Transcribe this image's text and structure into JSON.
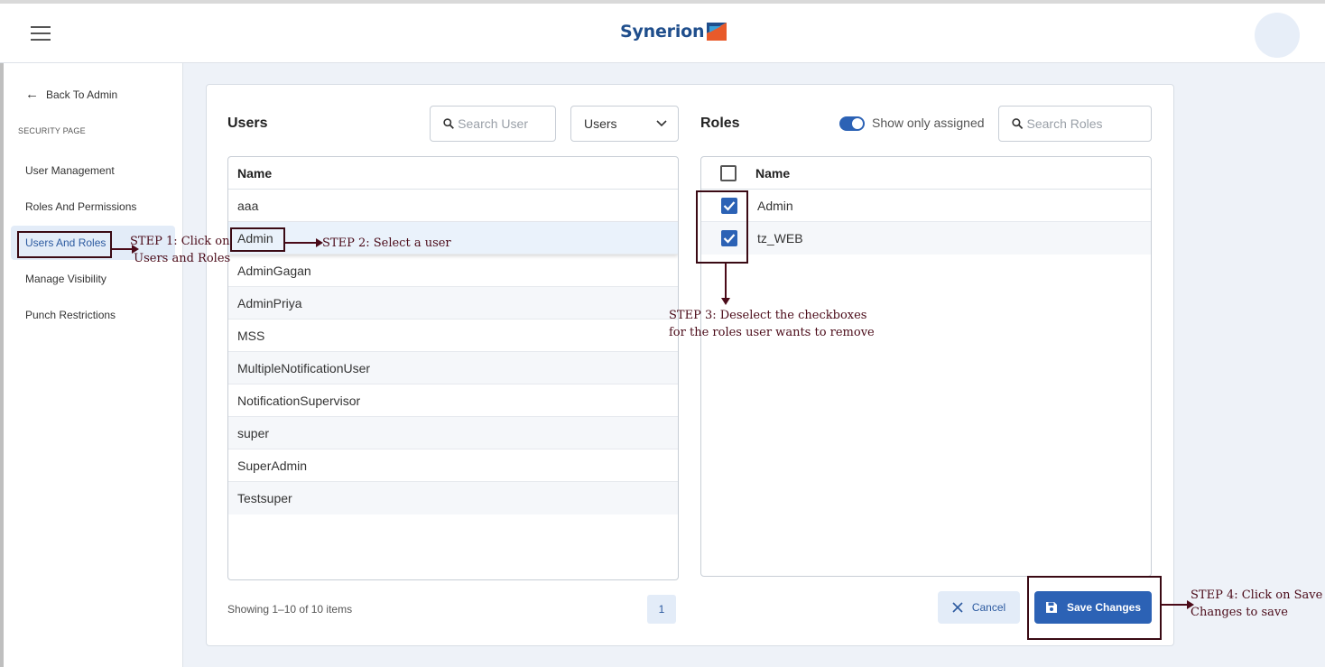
{
  "header": {
    "logo_text": "Synerion"
  },
  "sidebar": {
    "back_label": "Back To Admin",
    "section_label": "SECURITY PAGE",
    "items": [
      {
        "label": "User Management"
      },
      {
        "label": "Roles And Permissions"
      },
      {
        "label": "Users And Roles"
      },
      {
        "label": "Manage Visibility"
      },
      {
        "label": "Punch Restrictions"
      }
    ]
  },
  "users": {
    "title": "Users",
    "search_placeholder": "Search User",
    "filter_value": "Users",
    "column_name": "Name",
    "rows": [
      "aaa",
      "Admin",
      "AdminGagan",
      "AdminPriya",
      "MSS",
      "MultipleNotificationUser",
      "NotificationSupervisor",
      "super",
      "SuperAdmin",
      "Testsuper"
    ],
    "pager_info": "Showing 1–10 of 10 items",
    "current_page": "1"
  },
  "roles": {
    "title": "Roles",
    "toggle_label": "Show only assigned",
    "toggle_on": true,
    "search_placeholder": "Search Roles",
    "column_name": "Name",
    "rows": [
      {
        "name": "Admin",
        "checked": true
      },
      {
        "name": "tz_WEB",
        "checked": true
      }
    ]
  },
  "actions": {
    "cancel_label": "Cancel",
    "save_label": "Save Changes"
  },
  "annotations": {
    "step1": "STEP 1: Click on\n Users and Roles",
    "step2": "STEP 2: Select a user",
    "step3": "STEP 3: Deselect the checkboxes\nfor the roles user wants to remove",
    "step4": "STEP 4: Click on Save\nChanges to save"
  },
  "colors": {
    "accent": "#2c62b5",
    "annotation": "#4a0a18",
    "selected_bg": "#e3ecf8"
  }
}
